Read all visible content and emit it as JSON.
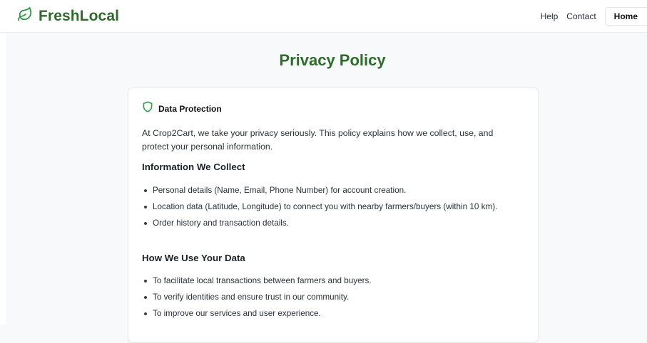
{
  "header": {
    "brand": "FreshLocal",
    "nav": {
      "help": "Help",
      "contact": "Contact",
      "home": "Home"
    }
  },
  "colors": {
    "brand_green": "#2f6b2b",
    "icon_green": "#2e9b47"
  },
  "page": {
    "title": "Privacy Policy"
  },
  "card": {
    "title": "Data Protection",
    "intro": "At Crop2Cart, we take your privacy seriously. This policy explains how we collect, use, and protect your personal information.",
    "sections": [
      {
        "heading": "Information We Collect",
        "items": [
          "Personal details (Name, Email, Phone Number) for account creation.",
          "Location data (Latitude, Longitude) to connect you with nearby farmers/buyers (within 10 km).",
          "Order history and transaction details."
        ]
      },
      {
        "heading": "How We Use Your Data",
        "items": [
          "To facilitate local transactions between farmers and buyers.",
          "To verify identities and ensure trust in our community.",
          "To improve our services and user experience."
        ]
      }
    ]
  }
}
